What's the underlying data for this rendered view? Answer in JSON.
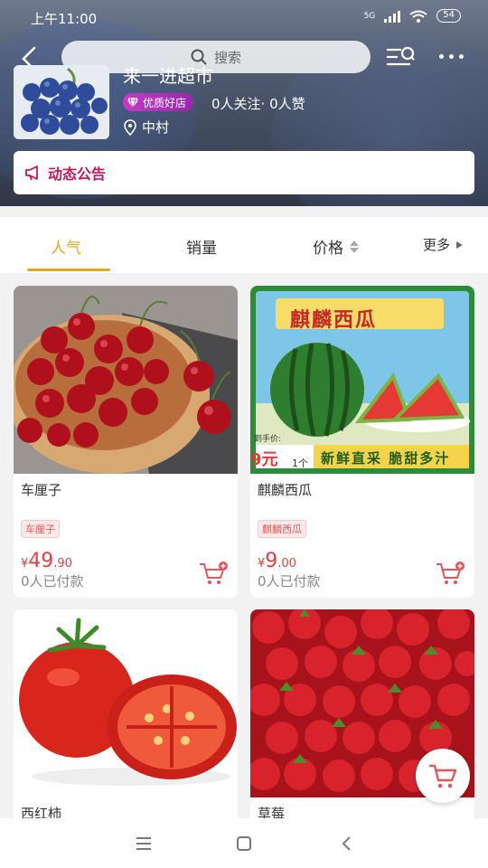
{
  "status_bar": {
    "time": "上午11:00",
    "network": "5G",
    "battery": "54"
  },
  "header": {
    "search_placeholder": "搜索",
    "store_name": "来一进超市",
    "badge_label": "优质好店",
    "follow_stats": "0人关注· 0人赞",
    "location": "中村",
    "notice_label": "动态公告"
  },
  "sort_tabs": [
    {
      "label": "人气",
      "active": true
    },
    {
      "label": "销量",
      "active": false
    },
    {
      "label": "价格",
      "active": false
    },
    {
      "label": "更多",
      "active": false
    }
  ],
  "products": [
    {
      "name": "车厘子",
      "tag": "车厘子",
      "price_yen": "¥",
      "price_int": "49",
      "price_dec": ".90",
      "paid": "0人已付款"
    },
    {
      "name": "麒麟西瓜",
      "tag": "麒麟西瓜",
      "price_yen": "¥",
      "price_int": "9",
      "price_dec": ".00",
      "paid": "0人已付款",
      "poster": {
        "title": "麒麟西瓜",
        "price_prefix": "到手价:",
        "price_value": "9元",
        "unit": "1个",
        "slogan": "新鲜直采 脆甜多汁"
      }
    },
    {
      "name": "西红柿"
    },
    {
      "name": "草莓"
    }
  ],
  "colors": {
    "accent": "#e2a816",
    "price": "#e0403e",
    "notice": "#c2185b",
    "badge": "#b030c0"
  }
}
